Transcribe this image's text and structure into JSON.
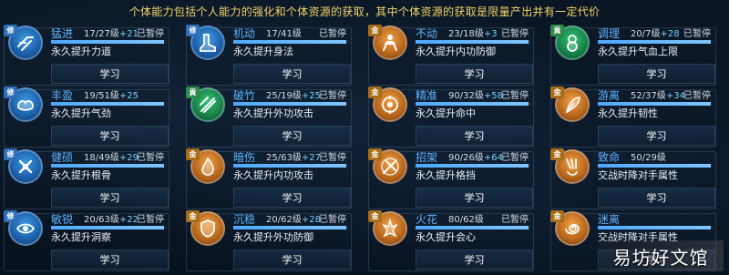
{
  "header": "个体能力包括个人能力的强化和个体资源的获取，其中个体资源的获取是限量产出并有一定代价",
  "learn_label": "学习",
  "watermark": "易坊好文馆",
  "colors": {
    "blue": "#1b5ea8",
    "green": "#168048",
    "gold": "#b6651a",
    "name": "#5fb2ff"
  },
  "skills": [
    {
      "badge": "修",
      "tier": "blue",
      "icon": "dash-icon",
      "name": "猛进",
      "level": "17/27级",
      "bonus": "+21",
      "paused": "已暂停",
      "progress": 0.98,
      "desc": "永久提升力道"
    },
    {
      "badge": "修",
      "tier": "blue",
      "icon": "boot-icon",
      "name": "机动",
      "level": "17/41级",
      "bonus": "",
      "paused": "已暂停",
      "progress": 0.98,
      "desc": "永久提升身法"
    },
    {
      "badge": "金",
      "tier": "gold",
      "icon": "body-icon",
      "name": "不动",
      "level": "23/18级",
      "bonus": "+3",
      "paused": "已暂停",
      "progress": 0.98,
      "desc": "永久提升内功防御"
    },
    {
      "badge": "貢",
      "tier": "green",
      "icon": "gourd-icon",
      "name": "调理",
      "level": "20/7级",
      "bonus": "+28",
      "paused": "已暂停",
      "progress": 0.98,
      "desc": "永久提升气血上限"
    },
    {
      "badge": "修",
      "tier": "blue",
      "icon": "muscle-icon",
      "name": "丰盈",
      "level": "19/51级",
      "bonus": "+25",
      "paused": "",
      "progress": 0.98,
      "desc": "永久提升气劲"
    },
    {
      "badge": "貢",
      "tier": "green",
      "icon": "bamboo-icon",
      "name": "破竹",
      "level": "25/19级",
      "bonus": "+25",
      "paused": "已暂停",
      "progress": 0.98,
      "desc": "永久提升外功攻击"
    },
    {
      "badge": "金",
      "tier": "gold",
      "icon": "target-icon",
      "name": "精准",
      "level": "90/32级",
      "bonus": "+58",
      "paused": "已暂停",
      "progress": 0.98,
      "desc": "永久提升命中"
    },
    {
      "badge": "金",
      "tier": "gold",
      "icon": "feather-icon",
      "name": "游离",
      "level": "52/37级",
      "bonus": "+34",
      "paused": "已暂停",
      "progress": 0.98,
      "desc": "永久提升韧性"
    },
    {
      "badge": "修",
      "tier": "blue",
      "icon": "bone-icon",
      "name": "健硕",
      "level": "18/49级",
      "bonus": "+29",
      "paused": "已暂停",
      "progress": 0.98,
      "desc": "永久提升根骨"
    },
    {
      "badge": "金",
      "tier": "gold",
      "icon": "fire-icon",
      "name": "暗伤",
      "level": "25/63级",
      "bonus": "+27",
      "paused": "已暂停",
      "progress": 0.98,
      "desc": "永久提升内功攻击"
    },
    {
      "badge": "金",
      "tier": "gold",
      "icon": "parry-icon",
      "name": "招架",
      "level": "90/26级",
      "bonus": "+64",
      "paused": "已暂停",
      "progress": 0.98,
      "desc": "永久提升格挡"
    },
    {
      "badge": "金",
      "tier": "gold",
      "icon": "claw-icon",
      "name": "致命",
      "level": "50/29级",
      "bonus": "",
      "paused": "",
      "progress": 0.98,
      "desc": "交战时降对手属性"
    },
    {
      "badge": "修",
      "tier": "blue",
      "icon": "eye-icon",
      "name": "敏锐",
      "level": "20/63级",
      "bonus": "+22",
      "paused": "已暂停",
      "progress": 0.98,
      "desc": "永久提升洞察"
    },
    {
      "badge": "金",
      "tier": "gold",
      "icon": "shield-icon",
      "name": "沉稳",
      "level": "20/62级",
      "bonus": "+28",
      "paused": "已暂停",
      "progress": 0.98,
      "desc": "永久提升外功防御"
    },
    {
      "badge": "金",
      "tier": "gold",
      "icon": "flame-icon",
      "name": "火花",
      "level": "80/62级",
      "bonus": "",
      "paused": "已暂停",
      "progress": 0.98,
      "desc": "永久提升会心"
    },
    {
      "badge": "金",
      "tier": "gold",
      "icon": "swirl-icon",
      "name": "迷离",
      "level": "",
      "bonus": "",
      "paused": "",
      "progress": 0.98,
      "desc": "交战时降对手属性"
    }
  ]
}
